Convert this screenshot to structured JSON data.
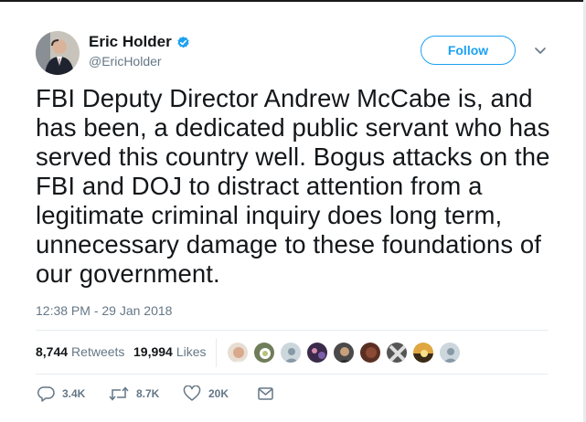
{
  "author": {
    "name": "Eric Holder",
    "handle": "@EricHolder"
  },
  "follow_label": "Follow",
  "tweet_text": "FBI Deputy Director Andrew McCabe is, and has been, a dedicated public servant who has served this country well. Bogus attacks on the FBI and DOJ to distract attention from a legitimate criminal inquiry does long term, unnecessary damage to these foundations of our government.",
  "timestamp": "12:38 PM - 29 Jan 2018",
  "stats": {
    "retweets_count": "8,744",
    "retweets_label": "Retweets",
    "likes_count": "19,994",
    "likes_label": "Likes"
  },
  "actions": {
    "reply_count": "3.4K",
    "retweet_count": "8.7K",
    "like_count": "20K"
  },
  "colors": {
    "accent": "#1da1f2",
    "muted": "#657786",
    "text": "#14171a",
    "divider": "#e6ecf0"
  },
  "icons": [
    "verified-badge-icon",
    "chevron-down-icon",
    "reply-icon",
    "retweet-icon",
    "heart-icon",
    "envelope-icon"
  ]
}
